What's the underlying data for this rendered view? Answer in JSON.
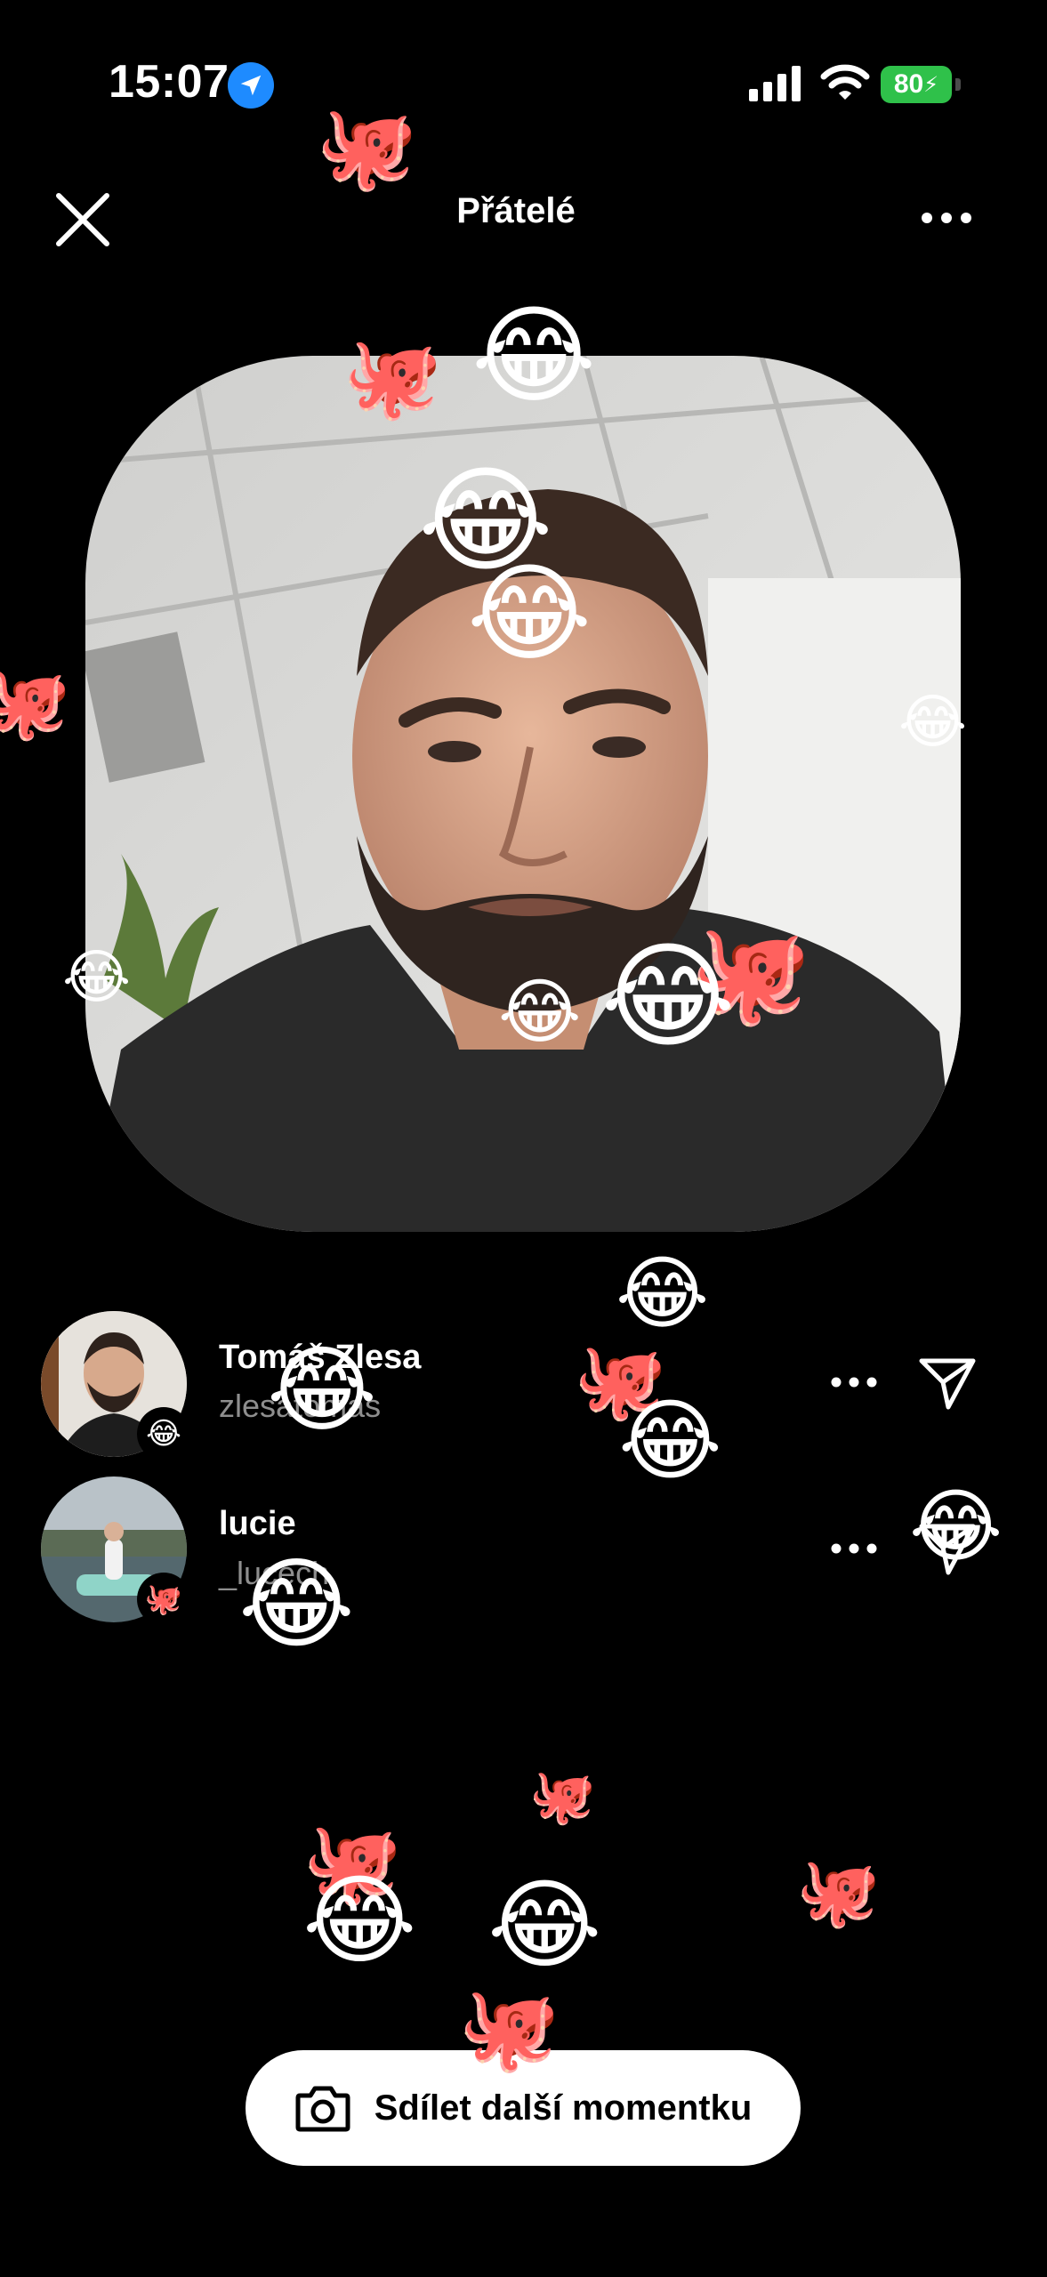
{
  "status_bar": {
    "time": "15:07",
    "battery": "80",
    "icons": [
      "location-arrow-icon",
      "cellular-signal-icon",
      "wifi-icon",
      "battery-charging-icon"
    ]
  },
  "header": {
    "title": "Přátelé",
    "close_icon": "close-icon",
    "more_icon": "more-horizontal-icon"
  },
  "friends": [
    {
      "name": "Tomáš Zlesa",
      "handle": "zlesatomas",
      "badge": "😂"
    },
    {
      "name": "lucie",
      "handle": "_lucech",
      "badge": "🐙"
    }
  ],
  "share_button": {
    "label": "Sdílet další momentku",
    "icon": "camera-icon"
  },
  "reactions": {
    "laugh": "😂",
    "octopus": "🐙"
  },
  "colors": {
    "background": "#000000",
    "location": "#1e8bff",
    "battery": "#2fc14a",
    "handle_text": "#8e8e8e"
  }
}
